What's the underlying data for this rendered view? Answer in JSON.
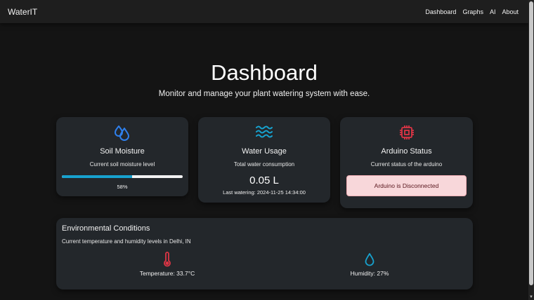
{
  "nav": {
    "brand": "WaterIT",
    "links": [
      "Dashboard",
      "Graphs",
      "AI",
      "About"
    ]
  },
  "hero": {
    "title": "Dashboard",
    "subtitle": "Monitor and manage your plant watering system with ease."
  },
  "cards": {
    "soil": {
      "title": "Soil Moisture",
      "text": "Current soil moisture level",
      "progress_percent": 58,
      "progress_label": "58%"
    },
    "water": {
      "title": "Water Usage",
      "text": "Total water consumption",
      "value": "0.05 L",
      "last_watering": "Last watering: 2024-11-25 14:34:00"
    },
    "arduino": {
      "title": "Arduino Status",
      "text": "Current status of the arduino",
      "alert": "Arduino is Disconnected"
    }
  },
  "environment": {
    "title": "Environmental Conditions",
    "description": "Current temperature and humidity levels in Delhi, IN",
    "temperature": "Temperature: 33.7°C",
    "humidity": "Humidity: 27%"
  },
  "colors": {
    "accent_blue": "#1f6feb",
    "accent_teal": "#17a2cf",
    "danger": "#dc3545"
  },
  "icons": [
    "droplets-icon",
    "waves-icon",
    "chip-icon",
    "thermometer-icon",
    "droplet-icon"
  ]
}
